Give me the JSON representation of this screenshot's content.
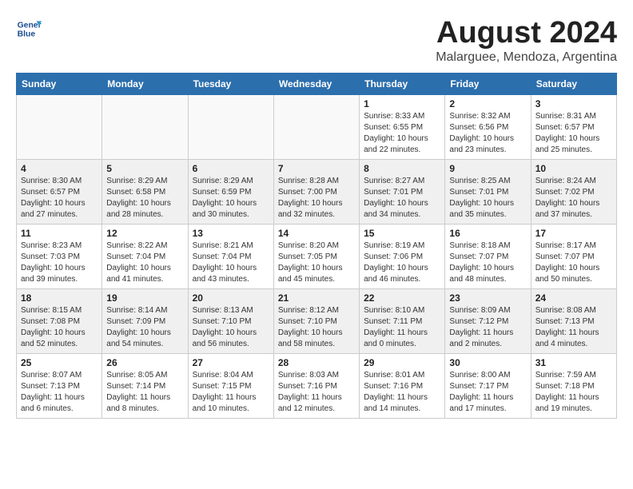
{
  "header": {
    "logo_line1": "General",
    "logo_line2": "Blue",
    "month_title": "August 2024",
    "subtitle": "Malarguee, Mendoza, Argentina"
  },
  "weekdays": [
    "Sunday",
    "Monday",
    "Tuesday",
    "Wednesday",
    "Thursday",
    "Friday",
    "Saturday"
  ],
  "weeks": [
    [
      {
        "day": "",
        "info": ""
      },
      {
        "day": "",
        "info": ""
      },
      {
        "day": "",
        "info": ""
      },
      {
        "day": "",
        "info": ""
      },
      {
        "day": "1",
        "info": "Sunrise: 8:33 AM\nSunset: 6:55 PM\nDaylight: 10 hours\nand 22 minutes."
      },
      {
        "day": "2",
        "info": "Sunrise: 8:32 AM\nSunset: 6:56 PM\nDaylight: 10 hours\nand 23 minutes."
      },
      {
        "day": "3",
        "info": "Sunrise: 8:31 AM\nSunset: 6:57 PM\nDaylight: 10 hours\nand 25 minutes."
      }
    ],
    [
      {
        "day": "4",
        "info": "Sunrise: 8:30 AM\nSunset: 6:57 PM\nDaylight: 10 hours\nand 27 minutes."
      },
      {
        "day": "5",
        "info": "Sunrise: 8:29 AM\nSunset: 6:58 PM\nDaylight: 10 hours\nand 28 minutes."
      },
      {
        "day": "6",
        "info": "Sunrise: 8:29 AM\nSunset: 6:59 PM\nDaylight: 10 hours\nand 30 minutes."
      },
      {
        "day": "7",
        "info": "Sunrise: 8:28 AM\nSunset: 7:00 PM\nDaylight: 10 hours\nand 32 minutes."
      },
      {
        "day": "8",
        "info": "Sunrise: 8:27 AM\nSunset: 7:01 PM\nDaylight: 10 hours\nand 34 minutes."
      },
      {
        "day": "9",
        "info": "Sunrise: 8:25 AM\nSunset: 7:01 PM\nDaylight: 10 hours\nand 35 minutes."
      },
      {
        "day": "10",
        "info": "Sunrise: 8:24 AM\nSunset: 7:02 PM\nDaylight: 10 hours\nand 37 minutes."
      }
    ],
    [
      {
        "day": "11",
        "info": "Sunrise: 8:23 AM\nSunset: 7:03 PM\nDaylight: 10 hours\nand 39 minutes."
      },
      {
        "day": "12",
        "info": "Sunrise: 8:22 AM\nSunset: 7:04 PM\nDaylight: 10 hours\nand 41 minutes."
      },
      {
        "day": "13",
        "info": "Sunrise: 8:21 AM\nSunset: 7:04 PM\nDaylight: 10 hours\nand 43 minutes."
      },
      {
        "day": "14",
        "info": "Sunrise: 8:20 AM\nSunset: 7:05 PM\nDaylight: 10 hours\nand 45 minutes."
      },
      {
        "day": "15",
        "info": "Sunrise: 8:19 AM\nSunset: 7:06 PM\nDaylight: 10 hours\nand 46 minutes."
      },
      {
        "day": "16",
        "info": "Sunrise: 8:18 AM\nSunset: 7:07 PM\nDaylight: 10 hours\nand 48 minutes."
      },
      {
        "day": "17",
        "info": "Sunrise: 8:17 AM\nSunset: 7:07 PM\nDaylight: 10 hours\nand 50 minutes."
      }
    ],
    [
      {
        "day": "18",
        "info": "Sunrise: 8:15 AM\nSunset: 7:08 PM\nDaylight: 10 hours\nand 52 minutes."
      },
      {
        "day": "19",
        "info": "Sunrise: 8:14 AM\nSunset: 7:09 PM\nDaylight: 10 hours\nand 54 minutes."
      },
      {
        "day": "20",
        "info": "Sunrise: 8:13 AM\nSunset: 7:10 PM\nDaylight: 10 hours\nand 56 minutes."
      },
      {
        "day": "21",
        "info": "Sunrise: 8:12 AM\nSunset: 7:10 PM\nDaylight: 10 hours\nand 58 minutes."
      },
      {
        "day": "22",
        "info": "Sunrise: 8:10 AM\nSunset: 7:11 PM\nDaylight: 11 hours\nand 0 minutes."
      },
      {
        "day": "23",
        "info": "Sunrise: 8:09 AM\nSunset: 7:12 PM\nDaylight: 11 hours\nand 2 minutes."
      },
      {
        "day": "24",
        "info": "Sunrise: 8:08 AM\nSunset: 7:13 PM\nDaylight: 11 hours\nand 4 minutes."
      }
    ],
    [
      {
        "day": "25",
        "info": "Sunrise: 8:07 AM\nSunset: 7:13 PM\nDaylight: 11 hours\nand 6 minutes."
      },
      {
        "day": "26",
        "info": "Sunrise: 8:05 AM\nSunset: 7:14 PM\nDaylight: 11 hours\nand 8 minutes."
      },
      {
        "day": "27",
        "info": "Sunrise: 8:04 AM\nSunset: 7:15 PM\nDaylight: 11 hours\nand 10 minutes."
      },
      {
        "day": "28",
        "info": "Sunrise: 8:03 AM\nSunset: 7:16 PM\nDaylight: 11 hours\nand 12 minutes."
      },
      {
        "day": "29",
        "info": "Sunrise: 8:01 AM\nSunset: 7:16 PM\nDaylight: 11 hours\nand 14 minutes."
      },
      {
        "day": "30",
        "info": "Sunrise: 8:00 AM\nSunset: 7:17 PM\nDaylight: 11 hours\nand 17 minutes."
      },
      {
        "day": "31",
        "info": "Sunrise: 7:59 AM\nSunset: 7:18 PM\nDaylight: 11 hours\nand 19 minutes."
      }
    ]
  ]
}
